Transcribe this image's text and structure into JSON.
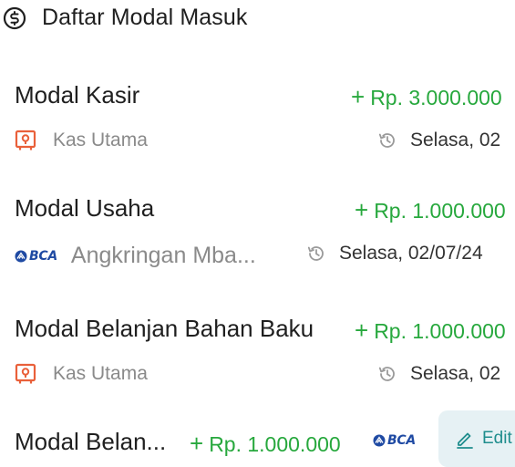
{
  "header": {
    "title": "Daftar Modal Masuk",
    "icon": "money-circle-icon"
  },
  "entries": [
    {
      "name": "Modal Kasir",
      "amount": "Rp. 3.000.000",
      "source": "Kas Utama",
      "source_icon": "safe-icon",
      "date": "Selasa, 02"
    },
    {
      "name": "Modal Usaha",
      "amount": "Rp. 1.000.000",
      "source": "Angkringan Mba...",
      "source_icon": "bca-logo",
      "date": "Selasa, 02/07/24"
    },
    {
      "name": "Modal Belanjan Bahan Baku",
      "amount": "Rp. 1.000.000",
      "source": "Kas Utama",
      "source_icon": "safe-icon",
      "date": "Selasa, 02"
    },
    {
      "name": "Modal Belan...",
      "amount": "Rp. 1.000.000",
      "source_icon": "bca-logo"
    }
  ],
  "plus_sign": "+",
  "bca_logo_text": "BCA",
  "edit_label": "Edit",
  "colors": {
    "amount": "#27a83d",
    "safe_icon": "#e9603a",
    "bca": "#1f4aa3",
    "edit_bg": "#e6f1f4",
    "edit_text": "#1f8d8d",
    "muted": "#8a8a8a"
  }
}
